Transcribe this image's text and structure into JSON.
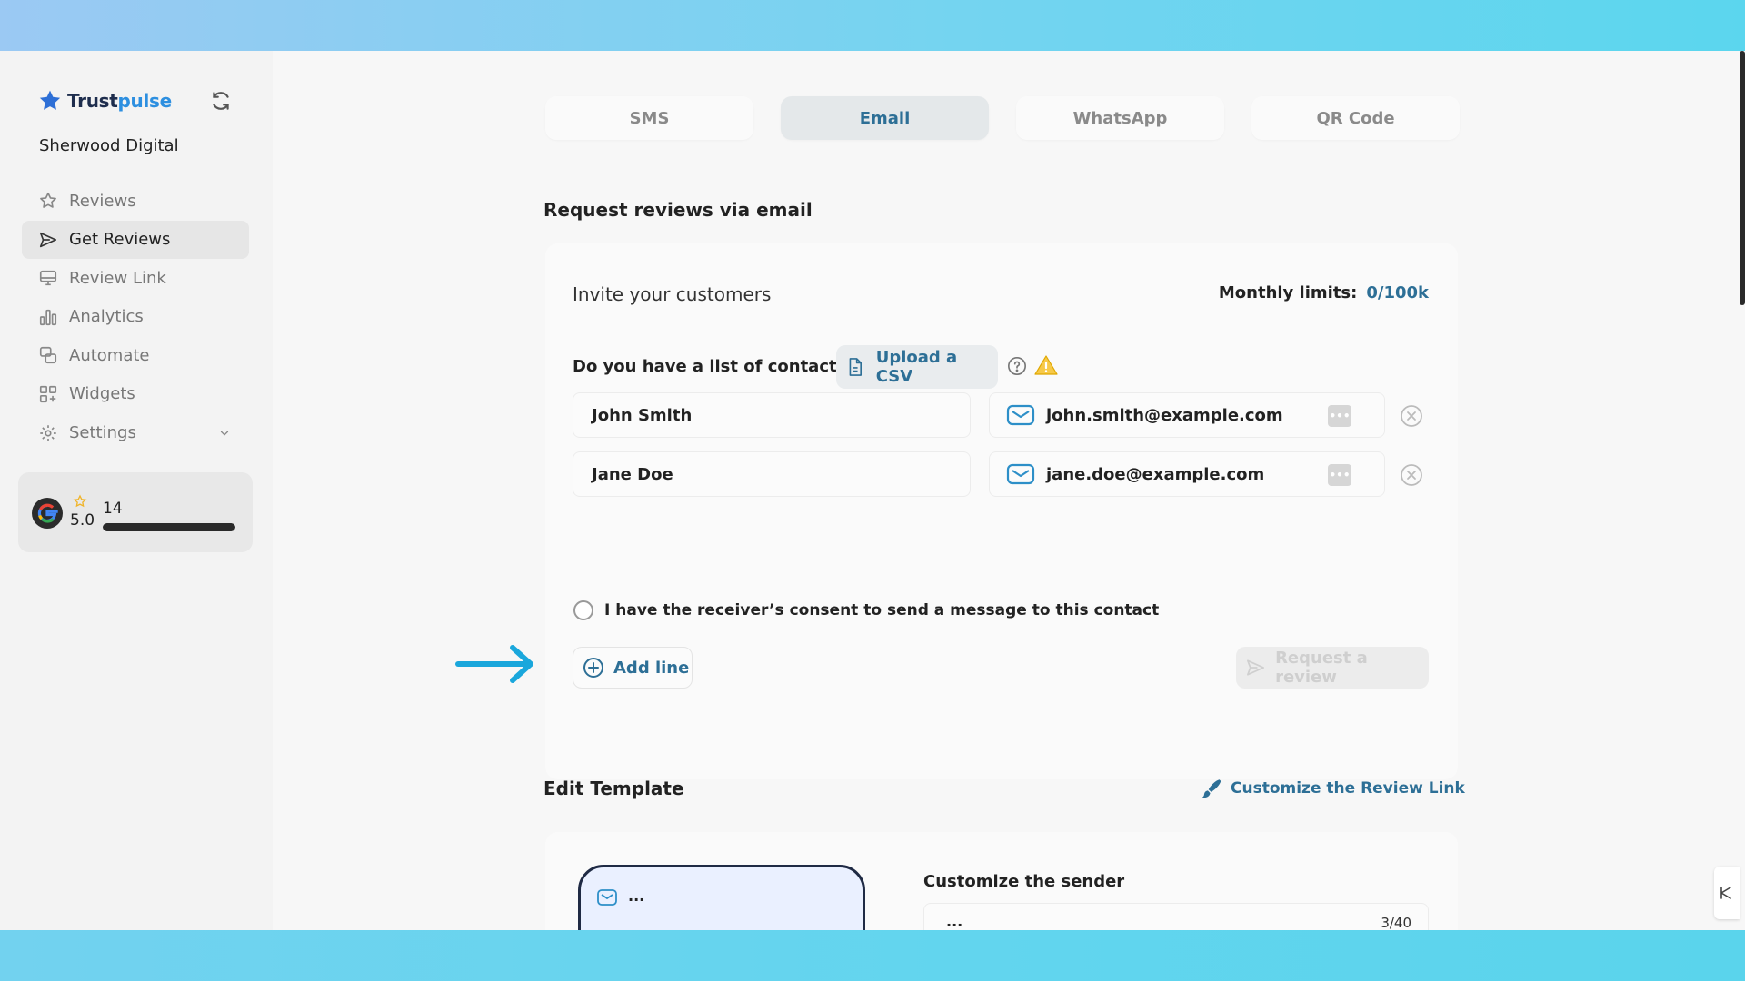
{
  "brand": {
    "part1": "Trust",
    "part2": "pulse"
  },
  "org_name": "Sherwood Digital",
  "sidebar": {
    "items": [
      {
        "label": "Reviews",
        "icon": "star-icon"
      },
      {
        "label": "Get Reviews",
        "icon": "send-icon",
        "active": true
      },
      {
        "label": "Review Link",
        "icon": "monitor-icon"
      },
      {
        "label": "Analytics",
        "icon": "bar-chart-icon"
      },
      {
        "label": "Automate",
        "icon": "automate-icon"
      },
      {
        "label": "Widgets",
        "icon": "widgets-icon"
      },
      {
        "label": "Settings",
        "icon": "gear-icon",
        "has_dropdown": true
      }
    ]
  },
  "google_card": {
    "rating": "5.0",
    "count": "14",
    "progress_percent": 100
  },
  "tabs": [
    {
      "label": "SMS"
    },
    {
      "label": "Email",
      "active": true
    },
    {
      "label": "WhatsApp"
    },
    {
      "label": "QR Code"
    }
  ],
  "request_section": {
    "title": "Request reviews via email",
    "invite_title": "Invite your customers",
    "limits_label": "Monthly limits:",
    "limits_value": "0/100k",
    "contacts_question": "Do you have a list of contacts?",
    "upload_label": "Upload a CSV",
    "contacts": [
      {
        "name": "John Smith",
        "email": "john.smith@example.com"
      },
      {
        "name": "Jane Doe",
        "email": "jane.doe@example.com"
      }
    ],
    "dots_label": "•••",
    "consent_label": "I have the receiver’s consent to send a message to this contact",
    "add_line_label": "Add line",
    "request_label": "Request a review"
  },
  "edit_template": {
    "title": "Edit Template",
    "customize_link_label": "Customize the Review Link",
    "phone_preview_text": "...",
    "sender_label": "Customize the sender",
    "sender_value": "...",
    "sender_count": "3/40"
  },
  "colors": {
    "accent": "#2d6f96",
    "brand_blue": "#2d8fe0",
    "arrow": "#1aa7dc"
  }
}
